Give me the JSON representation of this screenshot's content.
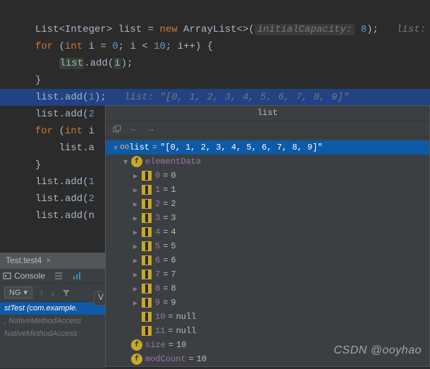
{
  "code": {
    "l1": {
      "a": "List<Integer> list = ",
      "kw": "new",
      "b": " ArrayList<>(",
      "hint": "initialCapacity:",
      "cap": " 8",
      "c": ");",
      "tail": "   list: "
    },
    "l2": {
      "a": "for",
      "b": " (",
      "c": "int",
      "d": " i = ",
      "z": "0",
      "e": "; i < ",
      "ten": "10",
      "f": "; i++) {"
    },
    "l3": {
      "a": "    ",
      "v": "list",
      "b": ".add(",
      "i": "i",
      "c": ");"
    },
    "l4": "}",
    "l5": {
      "a": "list.add(",
      "n": "1",
      "b": ");",
      "hint": "   list: \"[0, 1, 2, 3, 4, 5, 6, 7, 8, 9]\""
    },
    "l6": {
      "a": "list.add(",
      "n": "2"
    },
    "l7": {
      "a": "for",
      "b": " (",
      "c": "int",
      "d": " i"
    },
    "l8": "    list.a",
    "l9": "}",
    "l10": {
      "a": "list.add(",
      "n": "1"
    },
    "l11": {
      "a": "list.add(",
      "n": "2"
    },
    "l12": {
      "a": "list.add(",
      "n": "n"
    }
  },
  "popup": {
    "title": "list",
    "root": {
      "name": "list",
      "val": "\"[0, 1, 2, 3, 4, 5, 6, 7, 8, 9]\""
    },
    "elementData": "elementData",
    "items": [
      {
        "idx": "0",
        "val": "0"
      },
      {
        "idx": "1",
        "val": "1"
      },
      {
        "idx": "2",
        "val": "2"
      },
      {
        "idx": "3",
        "val": "3"
      },
      {
        "idx": "4",
        "val": "4"
      },
      {
        "idx": "5",
        "val": "5"
      },
      {
        "idx": "6",
        "val": "6"
      },
      {
        "idx": "7",
        "val": "7"
      },
      {
        "idx": "8",
        "val": "8"
      },
      {
        "idx": "9",
        "val": "9"
      },
      {
        "idx": "10",
        "val": "null"
      },
      {
        "idx": "11",
        "val": "null"
      }
    ],
    "size": {
      "name": "size",
      "val": "10"
    },
    "modCount": {
      "name": "modCount",
      "val": "10"
    }
  },
  "tabs": {
    "file": "Test.test4"
  },
  "panel": {
    "console": "Console",
    "thread": "NG",
    "varsHeader": "V",
    "plus": "+",
    "frames": {
      "f0": "stTest (com.example.",
      "f1": ", NativeMethodAccess",
      "f2": "NativeMethodAccess"
    }
  },
  "watermark": "CSDN @ooyhao"
}
